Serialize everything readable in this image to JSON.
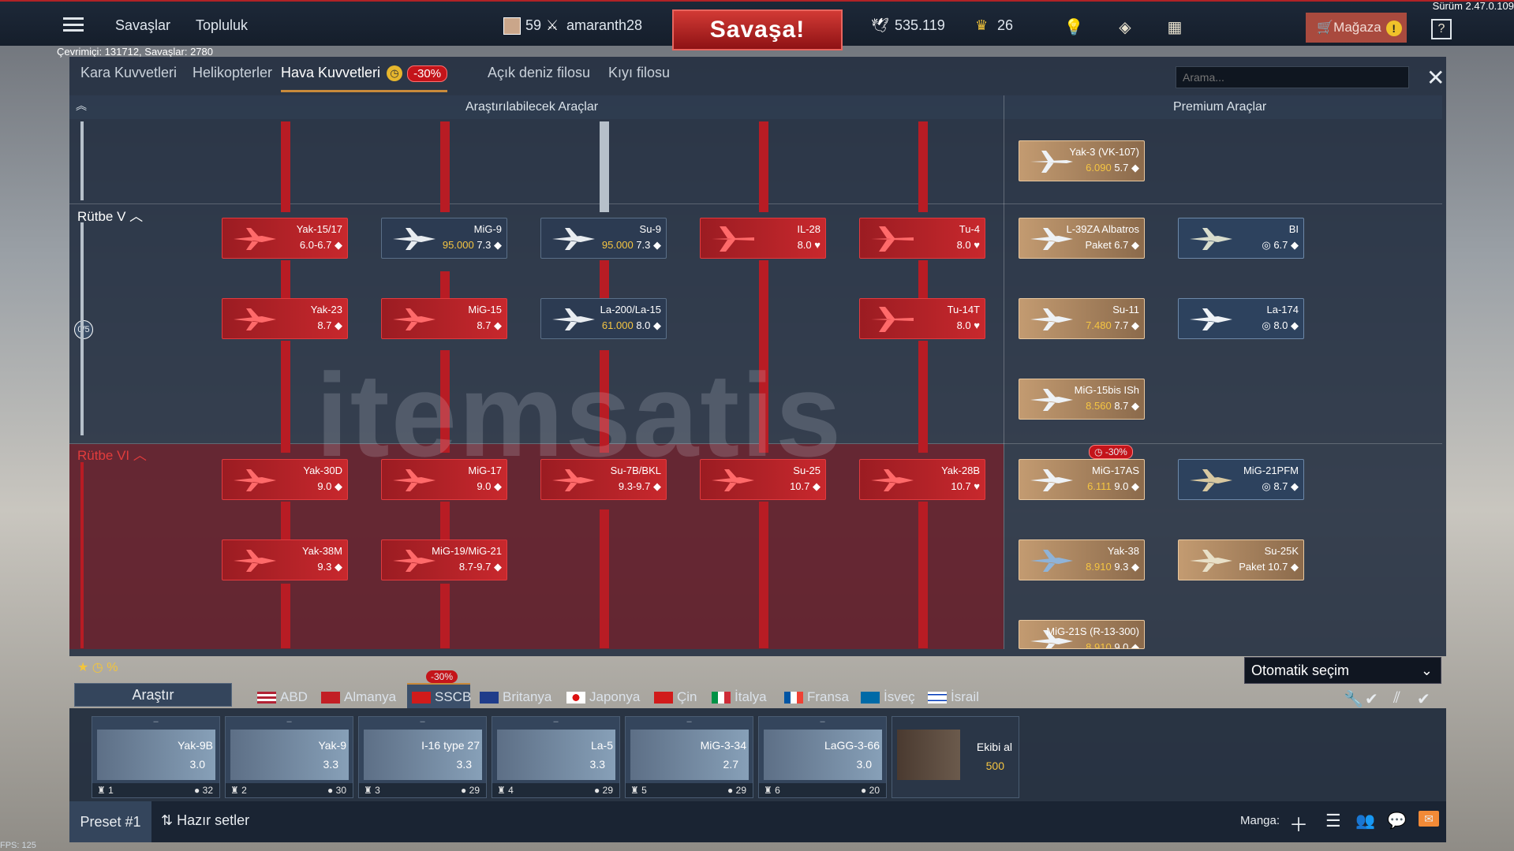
{
  "version": "Sürüm 2.47.0.109",
  "top": {
    "nav": [
      "Savaşlar",
      "Topluluk"
    ],
    "level": "59",
    "username": "amaranth28",
    "battle_button": "Savaşa!",
    "silver": "535.119",
    "gold": "26",
    "shop": "Mağaza"
  },
  "online": "Çevrimiçi: 131712, Savaşlar: 2780",
  "tabs": [
    "Kara Kuvvetleri",
    "Helikopterler",
    "Hava Kuvvetleri",
    "Açık deniz filosu",
    "Kıyı filosu"
  ],
  "tab_sale": "-30%",
  "search_placeholder": "Arama...",
  "headers": {
    "research": "Araştırılabilecek Araçlar",
    "premium": "Premium Araçlar"
  },
  "ranks": {
    "r5": "Rütbe V",
    "r6": "Rütbe VI",
    "progress": "0/5"
  },
  "research_cards": [
    {
      "name": "Yak-15/17",
      "br": "6.0-6.7"
    },
    {
      "name": "MiG-9",
      "cost": "95.000",
      "br": "7.3"
    },
    {
      "name": "Su-9",
      "cost": "95.000",
      "br": "7.3"
    },
    {
      "name": "IL-28",
      "br": "8.0"
    },
    {
      "name": "Tu-4",
      "br": "8.0"
    },
    {
      "name": "Yak-23",
      "br": "8.7"
    },
    {
      "name": "MiG-15",
      "br": "8.7"
    },
    {
      "name": "La-200/La-15",
      "cost": "61.000",
      "br": "8.0"
    },
    {
      "name": "Tu-14T",
      "br": "8.0"
    },
    {
      "name": "Yak-30D",
      "br": "9.0"
    },
    {
      "name": "MiG-17",
      "br": "9.0"
    },
    {
      "name": "Su-7B/BKL",
      "br": "9.3-9.7"
    },
    {
      "name": "Su-25",
      "br": "10.7"
    },
    {
      "name": "Yak-28B",
      "br": "10.7"
    },
    {
      "name": "Yak-38M",
      "br": "9.3"
    },
    {
      "name": "MiG-19/MiG-21",
      "br": "8.7-9.7"
    }
  ],
  "premium_cards": [
    {
      "name": "Yak-3 (VK-107)",
      "cost": "6.090",
      "br": "5.7"
    },
    {
      "name": "L-39ZA Albatros",
      "br": "Paket 6.7"
    },
    {
      "name": "BI",
      "br": "6.7"
    },
    {
      "name": "Su-11",
      "cost": "7.480",
      "br": "7.7"
    },
    {
      "name": "La-174",
      "br": "8.0"
    },
    {
      "name": "MiG-15bis ISh",
      "cost": "8.560",
      "br": "8.7"
    },
    {
      "name": "MiG-17AS",
      "cost": "6.111",
      "br": "9.0",
      "sale": "-30%"
    },
    {
      "name": "MiG-21PFM",
      "br": "8.7"
    },
    {
      "name": "Yak-38",
      "cost": "8.910",
      "br": "9.3"
    },
    {
      "name": "Su-25K",
      "br": "Paket 10.7"
    },
    {
      "name": "MiG-21S (R-13-300)",
      "cost": "8.910",
      "br": "9.0"
    }
  ],
  "auto_select": "Otomatik seçim",
  "research_button": "Araştır",
  "countries": [
    "ABD",
    "Almanya",
    "SSCB",
    "Britanya",
    "Japonya",
    "Çin",
    "İtalya",
    "Fransa",
    "İsveç",
    "İsrail"
  ],
  "country_sale": "-30%",
  "crew": [
    {
      "name": "Yak-9B",
      "br": "3.0",
      "num": "1",
      "rep": "32"
    },
    {
      "name": "Yak-9",
      "br": "3.3",
      "num": "2",
      "rep": "30"
    },
    {
      "name": "I-16 type 27",
      "br": "3.3",
      "num": "3",
      "rep": "29"
    },
    {
      "name": "La-5",
      "br": "3.3",
      "num": "4",
      "rep": "29"
    },
    {
      "name": "MiG-3-34",
      "br": "2.7",
      "num": "5",
      "rep": "29"
    },
    {
      "name": "LaGG-3-66",
      "br": "3.0",
      "num": "6",
      "rep": "20"
    }
  ],
  "crew_dash": "–",
  "buy_crew": {
    "label": "Ekibi al",
    "cost": "500"
  },
  "preset": "Preset #1",
  "ready_sets": "Hazır setler",
  "squad_label": "Manga:",
  "fps": "FPS: 125",
  "watermark": "itemsatis"
}
